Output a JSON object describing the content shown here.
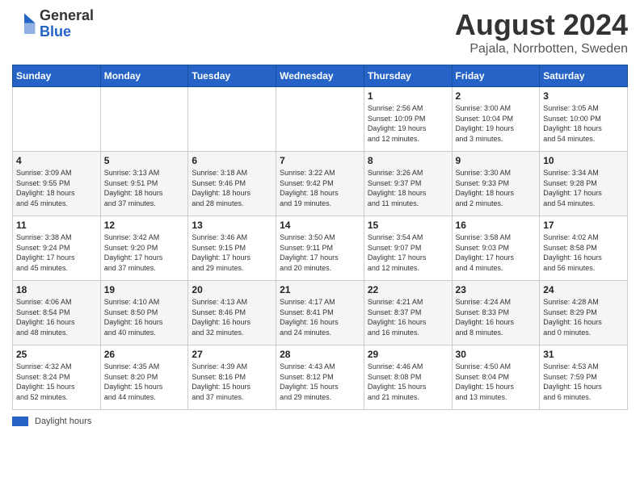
{
  "header": {
    "logo_general": "General",
    "logo_blue": "Blue",
    "month_title": "August 2024",
    "location": "Pajala, Norrbotten, Sweden"
  },
  "calendar": {
    "days_of_week": [
      "Sunday",
      "Monday",
      "Tuesday",
      "Wednesday",
      "Thursday",
      "Friday",
      "Saturday"
    ],
    "weeks": [
      [
        {
          "day": "",
          "info": ""
        },
        {
          "day": "",
          "info": ""
        },
        {
          "day": "",
          "info": ""
        },
        {
          "day": "",
          "info": ""
        },
        {
          "day": "1",
          "info": "Sunrise: 2:56 AM\nSunset: 10:09 PM\nDaylight: 19 hours\nand 12 minutes."
        },
        {
          "day": "2",
          "info": "Sunrise: 3:00 AM\nSunset: 10:04 PM\nDaylight: 19 hours\nand 3 minutes."
        },
        {
          "day": "3",
          "info": "Sunrise: 3:05 AM\nSunset: 10:00 PM\nDaylight: 18 hours\nand 54 minutes."
        }
      ],
      [
        {
          "day": "4",
          "info": "Sunrise: 3:09 AM\nSunset: 9:55 PM\nDaylight: 18 hours\nand 45 minutes."
        },
        {
          "day": "5",
          "info": "Sunrise: 3:13 AM\nSunset: 9:51 PM\nDaylight: 18 hours\nand 37 minutes."
        },
        {
          "day": "6",
          "info": "Sunrise: 3:18 AM\nSunset: 9:46 PM\nDaylight: 18 hours\nand 28 minutes."
        },
        {
          "day": "7",
          "info": "Sunrise: 3:22 AM\nSunset: 9:42 PM\nDaylight: 18 hours\nand 19 minutes."
        },
        {
          "day": "8",
          "info": "Sunrise: 3:26 AM\nSunset: 9:37 PM\nDaylight: 18 hours\nand 11 minutes."
        },
        {
          "day": "9",
          "info": "Sunrise: 3:30 AM\nSunset: 9:33 PM\nDaylight: 18 hours\nand 2 minutes."
        },
        {
          "day": "10",
          "info": "Sunrise: 3:34 AM\nSunset: 9:28 PM\nDaylight: 17 hours\nand 54 minutes."
        }
      ],
      [
        {
          "day": "11",
          "info": "Sunrise: 3:38 AM\nSunset: 9:24 PM\nDaylight: 17 hours\nand 45 minutes."
        },
        {
          "day": "12",
          "info": "Sunrise: 3:42 AM\nSunset: 9:20 PM\nDaylight: 17 hours\nand 37 minutes."
        },
        {
          "day": "13",
          "info": "Sunrise: 3:46 AM\nSunset: 9:15 PM\nDaylight: 17 hours\nand 29 minutes."
        },
        {
          "day": "14",
          "info": "Sunrise: 3:50 AM\nSunset: 9:11 PM\nDaylight: 17 hours\nand 20 minutes."
        },
        {
          "day": "15",
          "info": "Sunrise: 3:54 AM\nSunset: 9:07 PM\nDaylight: 17 hours\nand 12 minutes."
        },
        {
          "day": "16",
          "info": "Sunrise: 3:58 AM\nSunset: 9:03 PM\nDaylight: 17 hours\nand 4 minutes."
        },
        {
          "day": "17",
          "info": "Sunrise: 4:02 AM\nSunset: 8:58 PM\nDaylight: 16 hours\nand 56 minutes."
        }
      ],
      [
        {
          "day": "18",
          "info": "Sunrise: 4:06 AM\nSunset: 8:54 PM\nDaylight: 16 hours\nand 48 minutes."
        },
        {
          "day": "19",
          "info": "Sunrise: 4:10 AM\nSunset: 8:50 PM\nDaylight: 16 hours\nand 40 minutes."
        },
        {
          "day": "20",
          "info": "Sunrise: 4:13 AM\nSunset: 8:46 PM\nDaylight: 16 hours\nand 32 minutes."
        },
        {
          "day": "21",
          "info": "Sunrise: 4:17 AM\nSunset: 8:41 PM\nDaylight: 16 hours\nand 24 minutes."
        },
        {
          "day": "22",
          "info": "Sunrise: 4:21 AM\nSunset: 8:37 PM\nDaylight: 16 hours\nand 16 minutes."
        },
        {
          "day": "23",
          "info": "Sunrise: 4:24 AM\nSunset: 8:33 PM\nDaylight: 16 hours\nand 8 minutes."
        },
        {
          "day": "24",
          "info": "Sunrise: 4:28 AM\nSunset: 8:29 PM\nDaylight: 16 hours\nand 0 minutes."
        }
      ],
      [
        {
          "day": "25",
          "info": "Sunrise: 4:32 AM\nSunset: 8:24 PM\nDaylight: 15 hours\nand 52 minutes."
        },
        {
          "day": "26",
          "info": "Sunrise: 4:35 AM\nSunset: 8:20 PM\nDaylight: 15 hours\nand 44 minutes."
        },
        {
          "day": "27",
          "info": "Sunrise: 4:39 AM\nSunset: 8:16 PM\nDaylight: 15 hours\nand 37 minutes."
        },
        {
          "day": "28",
          "info": "Sunrise: 4:43 AM\nSunset: 8:12 PM\nDaylight: 15 hours\nand 29 minutes."
        },
        {
          "day": "29",
          "info": "Sunrise: 4:46 AM\nSunset: 8:08 PM\nDaylight: 15 hours\nand 21 minutes."
        },
        {
          "day": "30",
          "info": "Sunrise: 4:50 AM\nSunset: 8:04 PM\nDaylight: 15 hours\nand 13 minutes."
        },
        {
          "day": "31",
          "info": "Sunrise: 4:53 AM\nSunset: 7:59 PM\nDaylight: 15 hours\nand 6 minutes."
        }
      ]
    ]
  },
  "legend": {
    "label": "Daylight hours"
  }
}
